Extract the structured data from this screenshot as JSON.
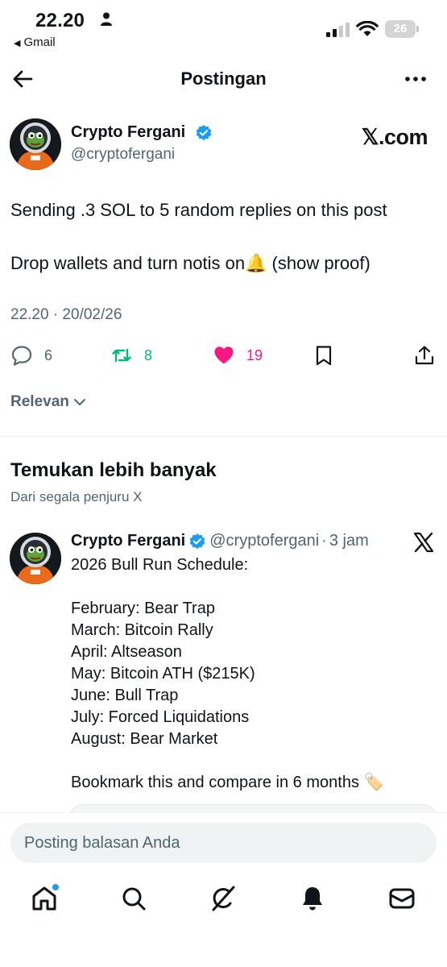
{
  "status_bar": {
    "time": "22.20",
    "back_app": "Gmail",
    "battery": "26"
  },
  "header": {
    "title": "Postingan"
  },
  "post": {
    "author_name": "Crypto Fergani",
    "author_handle": "@cryptofergani",
    "source_logo": "𝕏.com",
    "text_line1": "Sending .3 SOL to 5 random replies on this post",
    "text_line2": "Drop wallets and turn notis on🔔 (show proof)",
    "timestamp": "22.20 · 20/02/26",
    "replies": "6",
    "reposts": "8",
    "likes": "19"
  },
  "sort": {
    "label": "Relevan"
  },
  "discover": {
    "title": "Temukan lebih banyak",
    "subtitle": "Dari segala penjuru X"
  },
  "feed_post": {
    "author_name": "Crypto Fergani",
    "author_handle": "@cryptofergani",
    "separator": "·",
    "time": "3 jam",
    "lines": [
      "2026 Bull Run Schedule:",
      "",
      "February: Bear Trap",
      "March: Bitcoin Rally",
      "April: Altseason",
      "May: Bitcoin ATH ($215K)",
      "June: Bull Trap",
      "July: Forced Liquidations",
      "August: Bear Market",
      "",
      "Bookmark this and compare in 6 months 🏷️"
    ]
  },
  "reply": {
    "placeholder": "Posting balasan Anda"
  },
  "colors": {
    "accent": "#1d9bf0",
    "repost": "#00ba7c",
    "like": "#f91880",
    "secondary_text": "#536471"
  },
  "icons": {
    "back": "arrow-left-icon",
    "more": "more-horizontal-icon",
    "verified": "verified-badge-icon",
    "reply": "reply-bubble-icon",
    "repost": "repost-icon",
    "like": "heart-filled-icon",
    "bookmark": "bookmark-icon",
    "share": "share-icon",
    "home": "home-icon",
    "search": "search-icon",
    "grok": "grok-icon",
    "notifications": "bell-icon",
    "messages": "mail-icon"
  }
}
